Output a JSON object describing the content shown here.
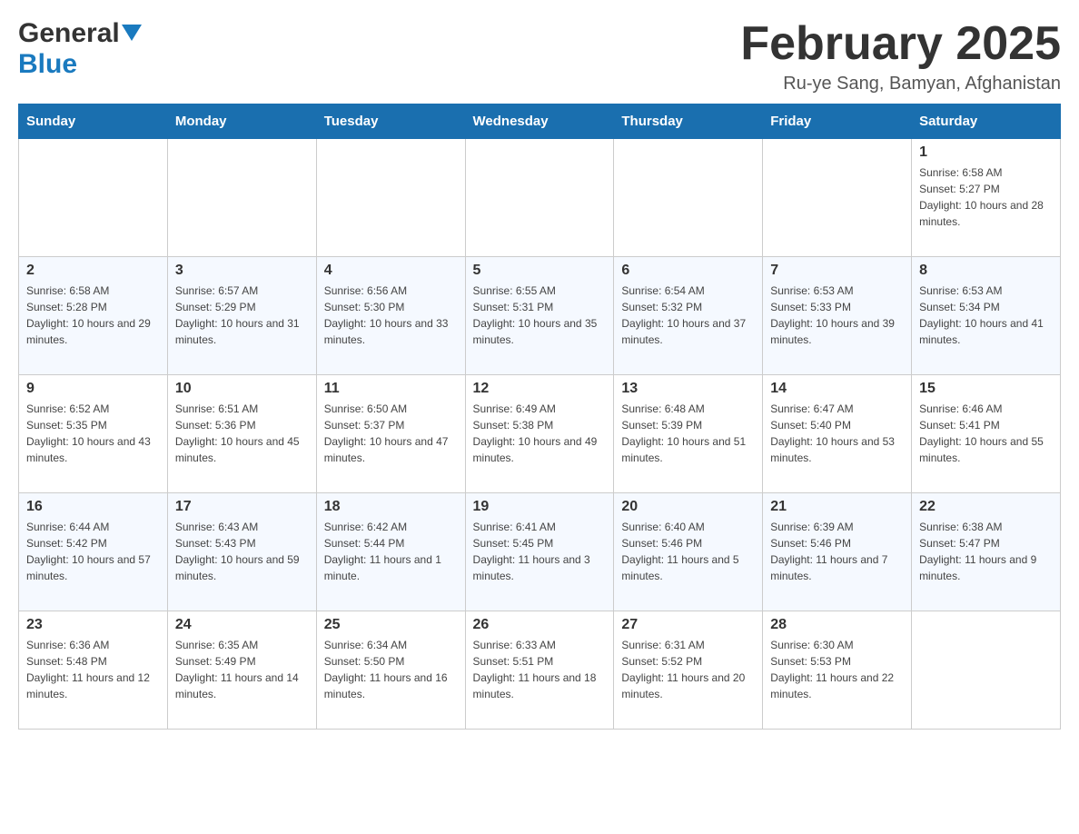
{
  "header": {
    "logo_general": "General",
    "logo_blue": "Blue",
    "title": "February 2025",
    "subtitle": "Ru-ye Sang, Bamyan, Afghanistan"
  },
  "days_of_week": [
    "Sunday",
    "Monday",
    "Tuesday",
    "Wednesday",
    "Thursday",
    "Friday",
    "Saturday"
  ],
  "weeks": [
    [
      {
        "day": "",
        "info": ""
      },
      {
        "day": "",
        "info": ""
      },
      {
        "day": "",
        "info": ""
      },
      {
        "day": "",
        "info": ""
      },
      {
        "day": "",
        "info": ""
      },
      {
        "day": "",
        "info": ""
      },
      {
        "day": "1",
        "info": "Sunrise: 6:58 AM\nSunset: 5:27 PM\nDaylight: 10 hours and 28 minutes."
      }
    ],
    [
      {
        "day": "2",
        "info": "Sunrise: 6:58 AM\nSunset: 5:28 PM\nDaylight: 10 hours and 29 minutes."
      },
      {
        "day": "3",
        "info": "Sunrise: 6:57 AM\nSunset: 5:29 PM\nDaylight: 10 hours and 31 minutes."
      },
      {
        "day": "4",
        "info": "Sunrise: 6:56 AM\nSunset: 5:30 PM\nDaylight: 10 hours and 33 minutes."
      },
      {
        "day": "5",
        "info": "Sunrise: 6:55 AM\nSunset: 5:31 PM\nDaylight: 10 hours and 35 minutes."
      },
      {
        "day": "6",
        "info": "Sunrise: 6:54 AM\nSunset: 5:32 PM\nDaylight: 10 hours and 37 minutes."
      },
      {
        "day": "7",
        "info": "Sunrise: 6:53 AM\nSunset: 5:33 PM\nDaylight: 10 hours and 39 minutes."
      },
      {
        "day": "8",
        "info": "Sunrise: 6:53 AM\nSunset: 5:34 PM\nDaylight: 10 hours and 41 minutes."
      }
    ],
    [
      {
        "day": "9",
        "info": "Sunrise: 6:52 AM\nSunset: 5:35 PM\nDaylight: 10 hours and 43 minutes."
      },
      {
        "day": "10",
        "info": "Sunrise: 6:51 AM\nSunset: 5:36 PM\nDaylight: 10 hours and 45 minutes."
      },
      {
        "day": "11",
        "info": "Sunrise: 6:50 AM\nSunset: 5:37 PM\nDaylight: 10 hours and 47 minutes."
      },
      {
        "day": "12",
        "info": "Sunrise: 6:49 AM\nSunset: 5:38 PM\nDaylight: 10 hours and 49 minutes."
      },
      {
        "day": "13",
        "info": "Sunrise: 6:48 AM\nSunset: 5:39 PM\nDaylight: 10 hours and 51 minutes."
      },
      {
        "day": "14",
        "info": "Sunrise: 6:47 AM\nSunset: 5:40 PM\nDaylight: 10 hours and 53 minutes."
      },
      {
        "day": "15",
        "info": "Sunrise: 6:46 AM\nSunset: 5:41 PM\nDaylight: 10 hours and 55 minutes."
      }
    ],
    [
      {
        "day": "16",
        "info": "Sunrise: 6:44 AM\nSunset: 5:42 PM\nDaylight: 10 hours and 57 minutes."
      },
      {
        "day": "17",
        "info": "Sunrise: 6:43 AM\nSunset: 5:43 PM\nDaylight: 10 hours and 59 minutes."
      },
      {
        "day": "18",
        "info": "Sunrise: 6:42 AM\nSunset: 5:44 PM\nDaylight: 11 hours and 1 minute."
      },
      {
        "day": "19",
        "info": "Sunrise: 6:41 AM\nSunset: 5:45 PM\nDaylight: 11 hours and 3 minutes."
      },
      {
        "day": "20",
        "info": "Sunrise: 6:40 AM\nSunset: 5:46 PM\nDaylight: 11 hours and 5 minutes."
      },
      {
        "day": "21",
        "info": "Sunrise: 6:39 AM\nSunset: 5:46 PM\nDaylight: 11 hours and 7 minutes."
      },
      {
        "day": "22",
        "info": "Sunrise: 6:38 AM\nSunset: 5:47 PM\nDaylight: 11 hours and 9 minutes."
      }
    ],
    [
      {
        "day": "23",
        "info": "Sunrise: 6:36 AM\nSunset: 5:48 PM\nDaylight: 11 hours and 12 minutes."
      },
      {
        "day": "24",
        "info": "Sunrise: 6:35 AM\nSunset: 5:49 PM\nDaylight: 11 hours and 14 minutes."
      },
      {
        "day": "25",
        "info": "Sunrise: 6:34 AM\nSunset: 5:50 PM\nDaylight: 11 hours and 16 minutes."
      },
      {
        "day": "26",
        "info": "Sunrise: 6:33 AM\nSunset: 5:51 PM\nDaylight: 11 hours and 18 minutes."
      },
      {
        "day": "27",
        "info": "Sunrise: 6:31 AM\nSunset: 5:52 PM\nDaylight: 11 hours and 20 minutes."
      },
      {
        "day": "28",
        "info": "Sunrise: 6:30 AM\nSunset: 5:53 PM\nDaylight: 11 hours and 22 minutes."
      },
      {
        "day": "",
        "info": ""
      }
    ]
  ]
}
